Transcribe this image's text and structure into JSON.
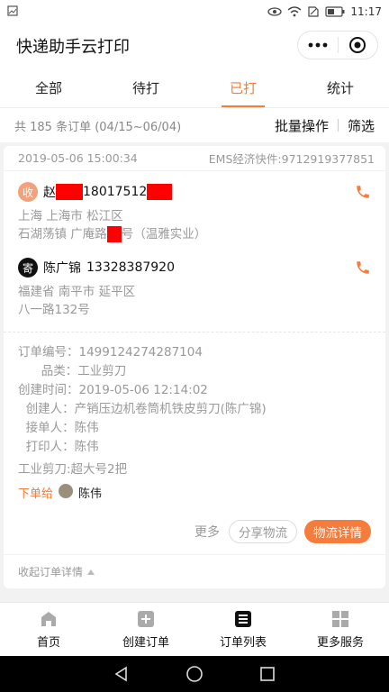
{
  "status_bar": {
    "time": "11:17"
  },
  "app": {
    "title": "快递助手云打印"
  },
  "tabs": [
    {
      "label": "全部",
      "active": false
    },
    {
      "label": "待打",
      "active": false
    },
    {
      "label": "已打",
      "active": true
    },
    {
      "label": "统计",
      "active": false
    }
  ],
  "summary": {
    "count_text": "共 185 条订单 (04/15~06/04)",
    "batch_label": "批量操作",
    "filter_label": "筛选"
  },
  "order": {
    "datetime": "2019-05-06 15:00:34",
    "tracking": "EMS经济快件:9712919377851",
    "receiver": {
      "tag": "收",
      "name": "赵",
      "phone": "18017512",
      "addr_line1": "上海 上海市 松江区",
      "addr_line2_a": "石湖荡镇 广庵路",
      "addr_line2_b": "号（温雅实业）"
    },
    "sender": {
      "tag": "寄",
      "name": "陈广锦",
      "phone": "13328387920",
      "addr_line1": "福建省 南平市 延平区",
      "addr_line2": "八一路132号"
    },
    "details": [
      {
        "label": "订单编号：",
        "value": "1499124274287104"
      },
      {
        "label": "      品类：",
        "value": "工业剪刀"
      },
      {
        "label": "创建时间：",
        "value": "2019-05-06 12:14:02"
      },
      {
        "label": "  创建人：",
        "value": "产销压边机卷筒机铁皮剪刀(陈广锦)"
      },
      {
        "label": "  接单人：",
        "value": "陈伟"
      },
      {
        "label": "  打印人：",
        "value": "陈伟"
      }
    ],
    "item_note": "工业剪刀:超大号2把",
    "order_to_label": "下单给",
    "order_to_name": "陈伟",
    "btn_more": "更多",
    "btn_share": "分享物流",
    "btn_detail": "物流详情",
    "collapse_label": "收起订单详情"
  },
  "bottom_nav": [
    {
      "label": "首页",
      "icon": "home-icon"
    },
    {
      "label": "创建订单",
      "icon": "plus-square-icon"
    },
    {
      "label": "订单列表",
      "icon": "list-icon"
    },
    {
      "label": "更多服务",
      "icon": "grid-icon"
    }
  ],
  "colors": {
    "accent": "#f47c3c",
    "redaction": "#ff0000"
  }
}
